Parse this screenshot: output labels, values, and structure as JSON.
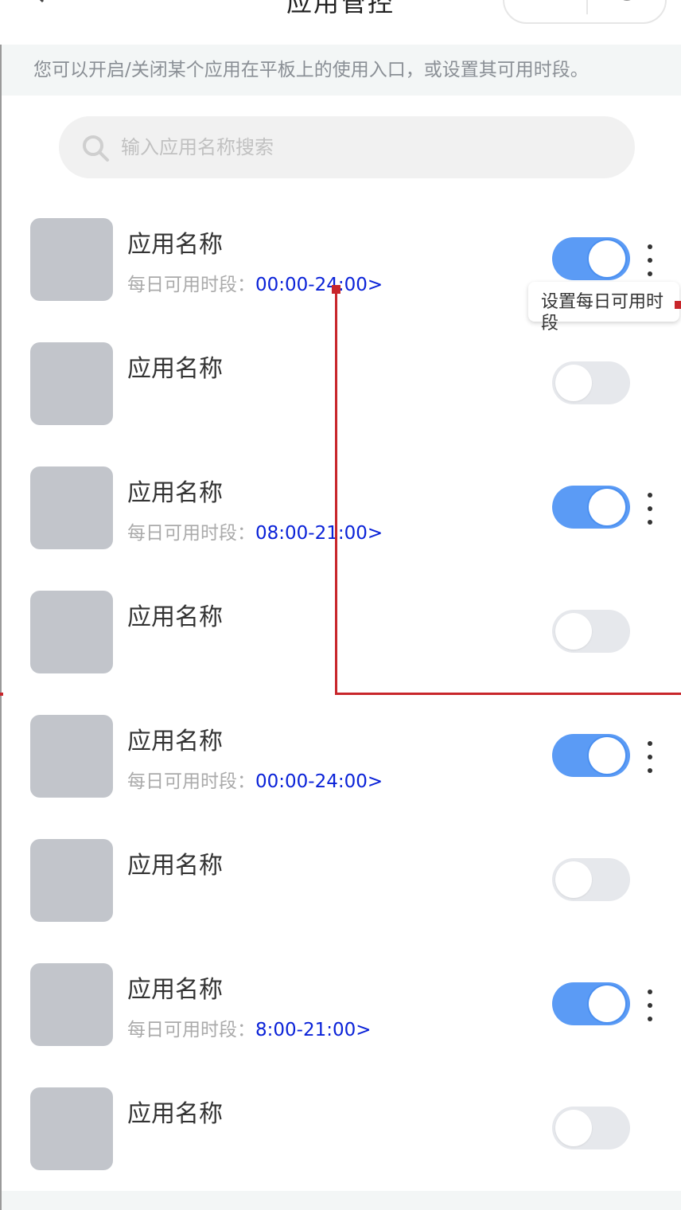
{
  "header": {
    "title": "应用管控",
    "back_icon": "chevron-left-icon",
    "more_icon": "more-dots-icon",
    "target_icon": "target-icon"
  },
  "notice": "您可以开启/关闭某个应用在平板上的使用入口，或设置其可用时段。",
  "search": {
    "placeholder": "输入应用名称搜索"
  },
  "apps": [
    {
      "name": "应用名称",
      "enabled": true,
      "time_label": "每日可用时段：",
      "time_value": "00:00-24:00>"
    },
    {
      "name": "应用名称",
      "enabled": false
    },
    {
      "name": "应用名称",
      "enabled": true,
      "time_label": "每日可用时段：",
      "time_value": "08:00-21:00>"
    },
    {
      "name": "应用名称",
      "enabled": false
    },
    {
      "name": "应用名称",
      "enabled": true,
      "time_label": "每日可用时段：",
      "time_value": "00:00-24:00>"
    },
    {
      "name": "应用名称",
      "enabled": false
    },
    {
      "name": "应用名称",
      "enabled": true,
      "time_label": "每日可用时段：",
      "time_value": "8:00-21:00>"
    },
    {
      "name": "应用名称",
      "enabled": false
    }
  ],
  "tooltip": {
    "text": "设置每日可用时段"
  },
  "colors": {
    "toggle_on": "#5b9bf5",
    "toggle_off": "#e6e8ec",
    "time_value": "#0a22d8",
    "annotation": "#c8262b"
  }
}
